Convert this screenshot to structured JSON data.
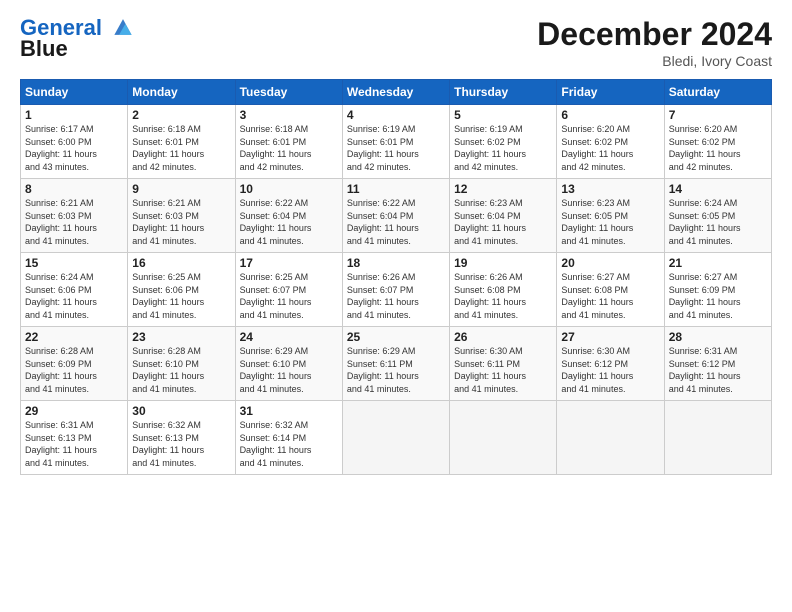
{
  "logo": {
    "line1": "General",
    "line2": "Blue"
  },
  "title": "December 2024",
  "subtitle": "Bledi, Ivory Coast",
  "weekdays": [
    "Sunday",
    "Monday",
    "Tuesday",
    "Wednesday",
    "Thursday",
    "Friday",
    "Saturday"
  ],
  "weeks": [
    [
      {
        "day": "1",
        "sunrise": "6:17 AM",
        "sunset": "6:00 PM",
        "daylight": "11 hours and 43 minutes."
      },
      {
        "day": "2",
        "sunrise": "6:18 AM",
        "sunset": "6:01 PM",
        "daylight": "11 hours and 42 minutes."
      },
      {
        "day": "3",
        "sunrise": "6:18 AM",
        "sunset": "6:01 PM",
        "daylight": "11 hours and 42 minutes."
      },
      {
        "day": "4",
        "sunrise": "6:19 AM",
        "sunset": "6:01 PM",
        "daylight": "11 hours and 42 minutes."
      },
      {
        "day": "5",
        "sunrise": "6:19 AM",
        "sunset": "6:02 PM",
        "daylight": "11 hours and 42 minutes."
      },
      {
        "day": "6",
        "sunrise": "6:20 AM",
        "sunset": "6:02 PM",
        "daylight": "11 hours and 42 minutes."
      },
      {
        "day": "7",
        "sunrise": "6:20 AM",
        "sunset": "6:02 PM",
        "daylight": "11 hours and 42 minutes."
      }
    ],
    [
      {
        "day": "8",
        "sunrise": "6:21 AM",
        "sunset": "6:03 PM",
        "daylight": "11 hours and 41 minutes."
      },
      {
        "day": "9",
        "sunrise": "6:21 AM",
        "sunset": "6:03 PM",
        "daylight": "11 hours and 41 minutes."
      },
      {
        "day": "10",
        "sunrise": "6:22 AM",
        "sunset": "6:04 PM",
        "daylight": "11 hours and 41 minutes."
      },
      {
        "day": "11",
        "sunrise": "6:22 AM",
        "sunset": "6:04 PM",
        "daylight": "11 hours and 41 minutes."
      },
      {
        "day": "12",
        "sunrise": "6:23 AM",
        "sunset": "6:04 PM",
        "daylight": "11 hours and 41 minutes."
      },
      {
        "day": "13",
        "sunrise": "6:23 AM",
        "sunset": "6:05 PM",
        "daylight": "11 hours and 41 minutes."
      },
      {
        "day": "14",
        "sunrise": "6:24 AM",
        "sunset": "6:05 PM",
        "daylight": "11 hours and 41 minutes."
      }
    ],
    [
      {
        "day": "15",
        "sunrise": "6:24 AM",
        "sunset": "6:06 PM",
        "daylight": "11 hours and 41 minutes."
      },
      {
        "day": "16",
        "sunrise": "6:25 AM",
        "sunset": "6:06 PM",
        "daylight": "11 hours and 41 minutes."
      },
      {
        "day": "17",
        "sunrise": "6:25 AM",
        "sunset": "6:07 PM",
        "daylight": "11 hours and 41 minutes."
      },
      {
        "day": "18",
        "sunrise": "6:26 AM",
        "sunset": "6:07 PM",
        "daylight": "11 hours and 41 minutes."
      },
      {
        "day": "19",
        "sunrise": "6:26 AM",
        "sunset": "6:08 PM",
        "daylight": "11 hours and 41 minutes."
      },
      {
        "day": "20",
        "sunrise": "6:27 AM",
        "sunset": "6:08 PM",
        "daylight": "11 hours and 41 minutes."
      },
      {
        "day": "21",
        "sunrise": "6:27 AM",
        "sunset": "6:09 PM",
        "daylight": "11 hours and 41 minutes."
      }
    ],
    [
      {
        "day": "22",
        "sunrise": "6:28 AM",
        "sunset": "6:09 PM",
        "daylight": "11 hours and 41 minutes."
      },
      {
        "day": "23",
        "sunrise": "6:28 AM",
        "sunset": "6:10 PM",
        "daylight": "11 hours and 41 minutes."
      },
      {
        "day": "24",
        "sunrise": "6:29 AM",
        "sunset": "6:10 PM",
        "daylight": "11 hours and 41 minutes."
      },
      {
        "day": "25",
        "sunrise": "6:29 AM",
        "sunset": "6:11 PM",
        "daylight": "11 hours and 41 minutes."
      },
      {
        "day": "26",
        "sunrise": "6:30 AM",
        "sunset": "6:11 PM",
        "daylight": "11 hours and 41 minutes."
      },
      {
        "day": "27",
        "sunrise": "6:30 AM",
        "sunset": "6:12 PM",
        "daylight": "11 hours and 41 minutes."
      },
      {
        "day": "28",
        "sunrise": "6:31 AM",
        "sunset": "6:12 PM",
        "daylight": "11 hours and 41 minutes."
      }
    ],
    [
      {
        "day": "29",
        "sunrise": "6:31 AM",
        "sunset": "6:13 PM",
        "daylight": "11 hours and 41 minutes."
      },
      {
        "day": "30",
        "sunrise": "6:32 AM",
        "sunset": "6:13 PM",
        "daylight": "11 hours and 41 minutes."
      },
      {
        "day": "31",
        "sunrise": "6:32 AM",
        "sunset": "6:14 PM",
        "daylight": "11 hours and 41 minutes."
      },
      null,
      null,
      null,
      null
    ]
  ]
}
